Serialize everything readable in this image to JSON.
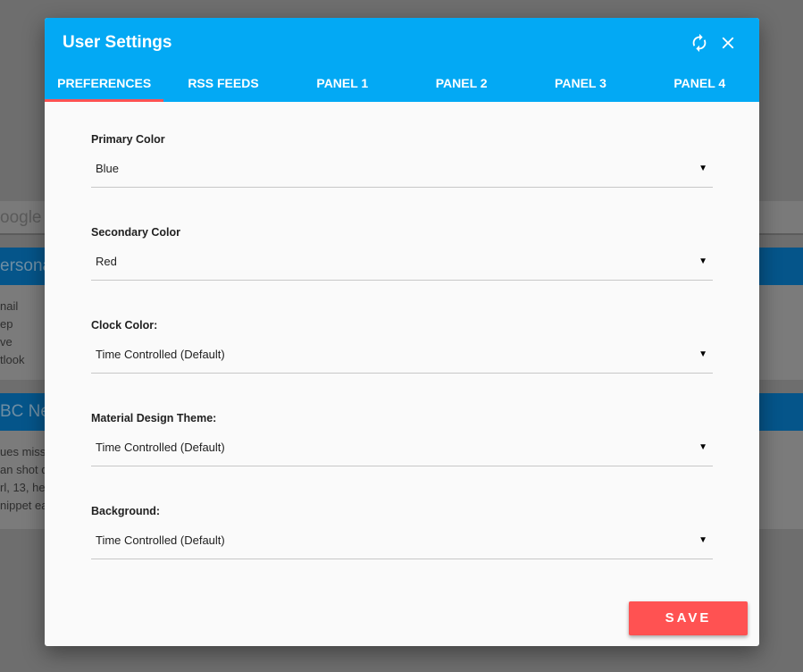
{
  "background": {
    "search_text": "oogle",
    "card1": {
      "title": "ersona",
      "lines": [
        "nail",
        "ep",
        "ve",
        "tlook"
      ]
    },
    "card2": {
      "title": "BC Ne",
      "lines": [
        "ues misse",
        "an shot d",
        "rl, 13, hel",
        "nippet ea"
      ]
    }
  },
  "dialog": {
    "title": "User Settings",
    "icons": {
      "refresh": "refresh-icon",
      "close": "close-icon"
    },
    "tabs": [
      {
        "label": "PREFERENCES",
        "active": true
      },
      {
        "label": "RSS FEEDS",
        "active": false
      },
      {
        "label": "PANEL 1",
        "active": false
      },
      {
        "label": "PANEL 2",
        "active": false
      },
      {
        "label": "PANEL 3",
        "active": false
      },
      {
        "label": "PANEL 4",
        "active": false
      }
    ],
    "fields": [
      {
        "label": "Primary Color",
        "value": "Blue"
      },
      {
        "label": "Secondary Color",
        "value": "Red"
      },
      {
        "label": "Clock Color:",
        "value": "Time Controlled (Default)"
      },
      {
        "label": "Material Design Theme:",
        "value": "Time Controlled (Default)"
      },
      {
        "label": "Background:",
        "value": "Time Controlled (Default)"
      }
    ],
    "save_label": "SAVE"
  },
  "colors": {
    "header": "#03a9f4",
    "accent": "#ff5252",
    "overlay": "#6e6e6e"
  }
}
